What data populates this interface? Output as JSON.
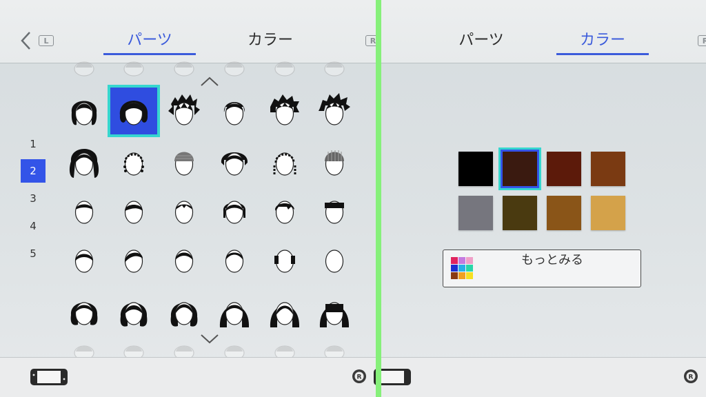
{
  "left_pane": {
    "tabs": [
      {
        "label": "パーツ",
        "active": true
      },
      {
        "label": "カラー",
        "active": false
      }
    ],
    "shoulder_left": "L",
    "shoulder_right": "R",
    "pages": [
      "1",
      "2",
      "3",
      "4",
      "5"
    ],
    "active_page": "2",
    "hair_grid": {
      "rows": 5,
      "cols": 6,
      "selected": {
        "row": 0,
        "col": 1
      }
    }
  },
  "right_pane": {
    "tabs": [
      {
        "label": "パーツ",
        "active": false
      },
      {
        "label": "カラー",
        "active": true
      }
    ],
    "shoulder_right": "R",
    "colors": [
      "#000000",
      "#3a1a10",
      "#5c1a0a",
      "#7a3a12",
      "#76767e",
      "#4a3a10",
      "#8a5518",
      "#d4a24a"
    ],
    "selected_color_index": 1,
    "more_button_label": "もっとみる",
    "palette_icon_colors": [
      "#e0245e",
      "#c47ae0",
      "#f0a0c8",
      "#1b2fd0",
      "#27b0e8",
      "#2ad6a8",
      "#8a3a12",
      "#f0a020",
      "#f5e020"
    ]
  },
  "accent": {
    "active_tab": "#3b5bdb",
    "selection": "#2f4de0",
    "selection_ring": "#36d6cf",
    "divider": "#86f07a"
  }
}
